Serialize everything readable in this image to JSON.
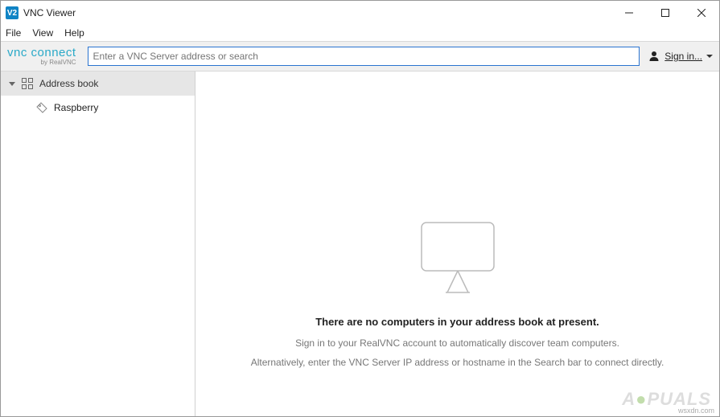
{
  "window": {
    "title": "VNC Viewer",
    "app_icon_text": "V2"
  },
  "menu": {
    "file": "File",
    "view": "View",
    "help": "Help"
  },
  "toolbar": {
    "brand_main": "vnc connect",
    "brand_sub": "by RealVNC",
    "search_placeholder": "Enter a VNC Server address or search",
    "search_value": "",
    "sign_in_label": "Sign in..."
  },
  "sidebar": {
    "header_label": "Address book",
    "items": [
      {
        "label": "Raspberry"
      }
    ]
  },
  "empty_state": {
    "title": "There are no computers in your address book at present.",
    "line1": "Sign in to your RealVNC account to automatically discover team computers.",
    "line2": "Alternatively, enter the VNC Server IP address or hostname in the Search bar to connect directly."
  },
  "watermark": {
    "site": "wsxdn.com"
  }
}
